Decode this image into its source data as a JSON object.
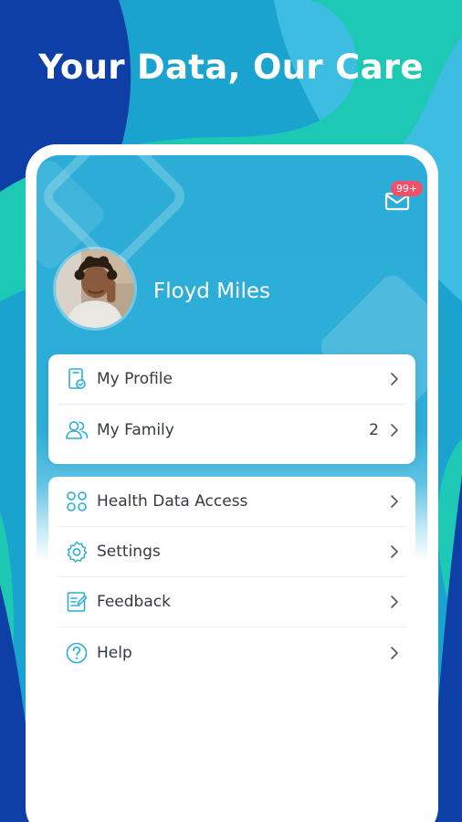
{
  "headline": "Your Data, Our Care",
  "colors": {
    "accent": "#2aaed8",
    "background_blue": "#1aa3cf",
    "dark_blue": "#0d3fa6",
    "teal": "#1dc8b4",
    "badge": "#f0506a"
  },
  "header": {
    "mail_icon": "mail-icon",
    "notification_badge": "99+"
  },
  "profile": {
    "name": "Floyd Miles"
  },
  "menu_group_1": [
    {
      "label": "My Profile",
      "icon": "profile-card-icon",
      "count": ""
    },
    {
      "label": "My Family",
      "icon": "family-icon",
      "count": "2"
    }
  ],
  "menu_group_2": [
    {
      "label": "Health Data Access",
      "icon": "grid-icon"
    },
    {
      "label": "Settings",
      "icon": "gear-icon"
    },
    {
      "label": "Feedback",
      "icon": "feedback-icon"
    },
    {
      "label": "Help",
      "icon": "help-icon"
    }
  ]
}
